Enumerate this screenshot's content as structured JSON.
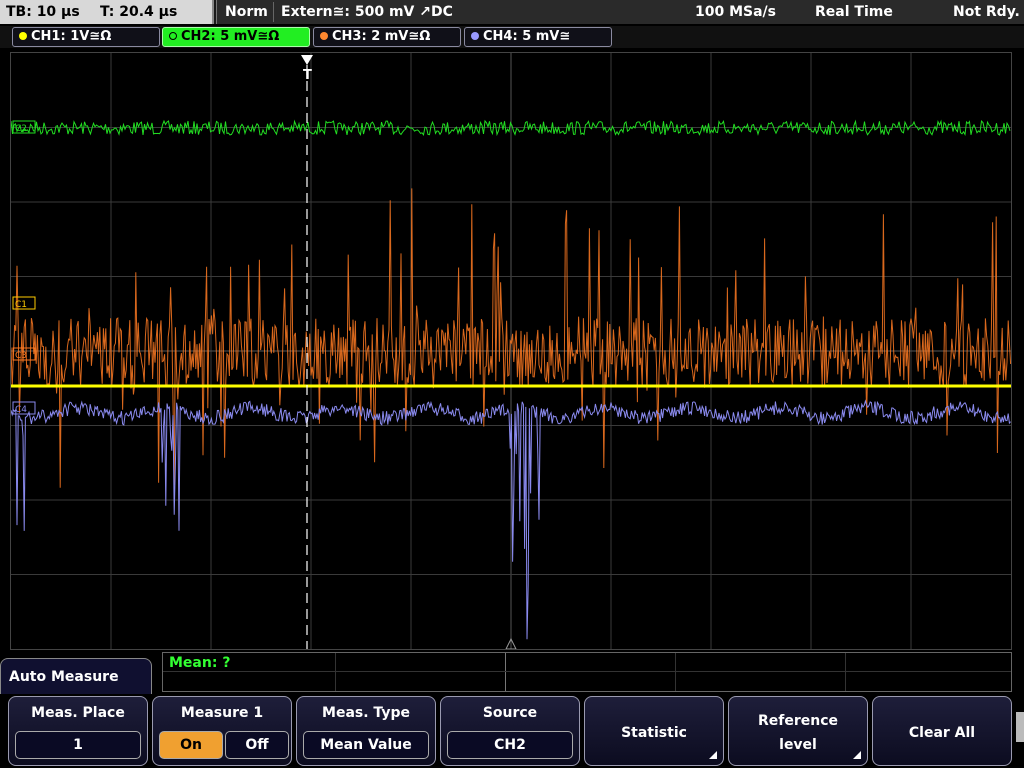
{
  "topbar": {
    "timebase": "TB: 10 µs",
    "trigger_time": "T: 20.4 µs",
    "mode": "Norm",
    "trigger_source": "Extern≅: 500 mV ↗DC",
    "sample_rate": "100 MSa/s",
    "acq_mode": "Real Time",
    "status": "Not Rdy."
  },
  "channels": [
    {
      "label": "CH1: 1V≅Ω",
      "color": "#ffff00",
      "active": false
    },
    {
      "label": "CH2: 5 mV≅Ω",
      "color": "#22ee22",
      "active": true
    },
    {
      "label": "CH3: 2 mV≅Ω",
      "color": "#ff8830",
      "active": false
    },
    {
      "label": "CH4: 5 mV≅",
      "color": "#9999ff",
      "active": false
    }
  ],
  "scope": {
    "markers": {
      "c2": "C2",
      "c1": "C1",
      "c3": "C3",
      "c4": "C4",
      "trigger": "T"
    },
    "colors": {
      "ch1": "#ffff00",
      "ch2": "#22dd22",
      "ch3": "#ff7a22",
      "ch4": "#8a8aee",
      "grid": "#3a3a3a"
    }
  },
  "measurement": {
    "readout": "Mean: ?"
  },
  "menu": {
    "title": "Auto Measure",
    "meas_place": {
      "title": "Meas. Place",
      "value": "1"
    },
    "measure1": {
      "title": "Measure 1",
      "on": "On",
      "off": "Off"
    },
    "meas_type": {
      "title": "Meas. Type",
      "value": "Mean Value"
    },
    "source": {
      "title": "Source",
      "value": "CH2"
    },
    "statistic": {
      "title": "Statistic"
    },
    "reference": {
      "line1": "Reference",
      "line2": "level"
    },
    "clear_all": {
      "title": "Clear All"
    }
  }
}
